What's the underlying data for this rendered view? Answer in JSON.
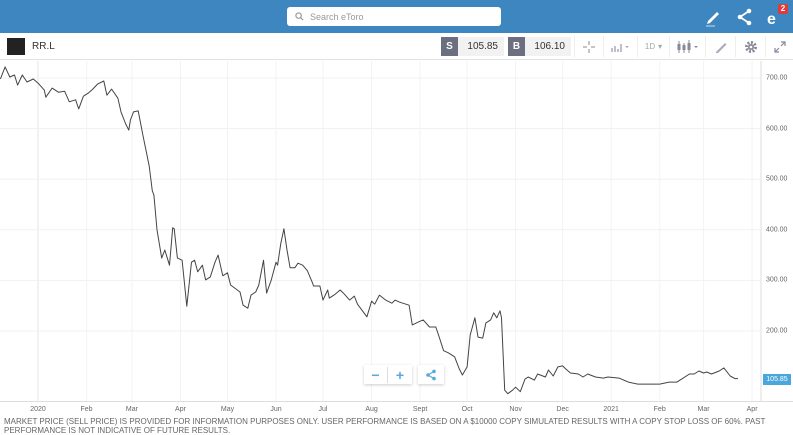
{
  "topbar": {
    "search_placeholder": "Search eToro",
    "notification_count": "2",
    "icons": [
      "edit-icon",
      "share-icon",
      "etoro-notifications-icon"
    ]
  },
  "toolbar": {
    "symbol": "RR.L",
    "sell_label": "S",
    "sell_price": "105.85",
    "buy_label": "B",
    "buy_price": "106.10",
    "timeframe": "1D",
    "icons": [
      "crosshair-icon",
      "chart-type-icon",
      "candles-icon",
      "draw-icon",
      "settings-icon",
      "fullscreen-icon"
    ]
  },
  "colors": {
    "topbar": "#3d86bf",
    "accent": "#4aa6db",
    "line": "#444444"
  },
  "chart_data": {
    "type": "line",
    "current_price_label": "105.85",
    "x_ticks": [
      "2020",
      "Feb",
      "Mar",
      "Apr",
      "May",
      "Jun",
      "Jul",
      "Aug",
      "Sept",
      "Oct",
      "Nov",
      "Dec",
      "2021",
      "Feb",
      "Mar",
      "Apr"
    ],
    "y_ticks": [
      "700.00",
      "600.00",
      "500.00",
      "400.00",
      "300.00",
      "200.00"
    ],
    "ylim": [
      60,
      740
    ],
    "grid": true,
    "series": [
      {
        "points": [
          [
            "2019-12-08",
            698
          ],
          [
            "2019-12-11",
            722
          ],
          [
            "2019-12-14",
            702
          ],
          [
            "2019-12-17",
            706
          ],
          [
            "2019-12-19",
            686
          ],
          [
            "2019-12-22",
            706
          ],
          [
            "2019-12-25",
            692
          ],
          [
            "2019-12-29",
            698
          ],
          [
            "2020-01-01",
            690
          ],
          [
            "2020-01-05",
            676
          ],
          [
            "2020-01-06",
            662
          ],
          [
            "2020-01-10",
            680
          ],
          [
            "2020-01-14",
            672
          ],
          [
            "2020-01-18",
            674
          ],
          [
            "2020-01-21",
            653
          ],
          [
            "2020-01-25",
            657
          ],
          [
            "2020-01-27",
            639
          ],
          [
            "2020-01-30",
            664
          ],
          [
            "2020-02-02",
            670
          ],
          [
            "2020-02-05",
            678
          ],
          [
            "2020-02-08",
            688
          ],
          [
            "2020-02-12",
            694
          ],
          [
            "2020-02-14",
            666
          ],
          [
            "2020-02-17",
            678
          ],
          [
            "2020-02-21",
            660
          ],
          [
            "2020-02-23",
            633
          ],
          [
            "2020-02-26",
            609
          ],
          [
            "2020-02-28",
            597
          ],
          [
            "2020-02-29",
            617
          ],
          [
            "2020-03-02",
            633
          ],
          [
            "2020-03-05",
            635
          ],
          [
            "2020-03-08",
            587
          ],
          [
            "2020-03-12",
            526
          ],
          [
            "2020-03-14",
            477
          ],
          [
            "2020-03-15",
            469
          ],
          [
            "2020-03-17",
            400
          ],
          [
            "2020-03-20",
            344
          ],
          [
            "2020-03-22",
            360
          ],
          [
            "2020-03-25",
            330
          ],
          [
            "2020-03-27",
            404
          ],
          [
            "2020-03-28",
            402
          ],
          [
            "2020-03-30",
            344
          ],
          [
            "2020-04-02",
            340
          ],
          [
            "2020-04-05",
            249
          ],
          [
            "2020-04-08",
            336
          ],
          [
            "2020-04-10",
            340
          ],
          [
            "2020-04-12",
            317
          ],
          [
            "2020-04-15",
            330
          ],
          [
            "2020-04-17",
            301
          ],
          [
            "2020-04-20",
            307
          ],
          [
            "2020-04-23",
            336
          ],
          [
            "2020-04-25",
            350
          ],
          [
            "2020-04-28",
            309
          ],
          [
            "2020-05-01",
            315
          ],
          [
            "2020-05-03",
            291
          ],
          [
            "2020-05-09",
            277
          ],
          [
            "2020-05-11",
            251
          ],
          [
            "2020-05-14",
            245
          ],
          [
            "2020-05-16",
            271
          ],
          [
            "2020-05-19",
            277
          ],
          [
            "2020-05-21",
            291
          ],
          [
            "2020-05-24",
            340
          ],
          [
            "2020-05-26",
            275
          ],
          [
            "2020-05-29",
            301
          ],
          [
            "2020-06-01",
            336
          ],
          [
            "2020-06-02",
            330
          ],
          [
            "2020-06-04",
            372
          ],
          [
            "2020-06-06",
            402
          ],
          [
            "2020-06-08",
            360
          ],
          [
            "2020-06-10",
            325
          ],
          [
            "2020-06-13",
            325
          ],
          [
            "2020-06-15",
            334
          ],
          [
            "2020-06-18",
            330
          ],
          [
            "2020-06-21",
            319
          ],
          [
            "2020-06-24",
            297
          ],
          [
            "2020-06-25",
            289
          ],
          [
            "2020-06-29",
            289
          ],
          [
            "2020-07-01",
            261
          ],
          [
            "2020-07-04",
            281
          ],
          [
            "2020-07-05",
            265
          ],
          [
            "2020-07-08",
            271
          ],
          [
            "2020-07-12",
            281
          ],
          [
            "2020-07-14",
            275
          ],
          [
            "2020-07-18",
            261
          ],
          [
            "2020-07-21",
            269
          ],
          [
            "2020-07-23",
            253
          ],
          [
            "2020-07-29",
            228
          ],
          [
            "2020-08-01",
            259
          ],
          [
            "2020-08-03",
            253
          ],
          [
            "2020-08-06",
            271
          ],
          [
            "2020-08-10",
            261
          ],
          [
            "2020-08-14",
            255
          ],
          [
            "2020-08-16",
            261
          ],
          [
            "2020-08-19",
            257
          ],
          [
            "2020-08-25",
            251
          ],
          [
            "2020-08-27",
            212
          ],
          [
            "2020-08-31",
            218
          ],
          [
            "2020-09-03",
            222
          ],
          [
            "2020-09-07",
            208
          ],
          [
            "2020-09-11",
            208
          ],
          [
            "2020-09-13",
            190
          ],
          [
            "2020-09-16",
            161
          ],
          [
            "2020-09-19",
            157
          ],
          [
            "2020-09-23",
            149
          ],
          [
            "2020-09-26",
            125
          ],
          [
            "2020-09-28",
            113
          ],
          [
            "2020-10-01",
            129
          ],
          [
            "2020-10-03",
            192
          ],
          [
            "2020-10-06",
            226
          ],
          [
            "2020-10-08",
            188
          ],
          [
            "2020-10-11",
            186
          ],
          [
            "2020-10-13",
            216
          ],
          [
            "2020-10-16",
            222
          ],
          [
            "2020-10-18",
            236
          ],
          [
            "2020-10-20",
            226
          ],
          [
            "2020-10-22",
            240
          ],
          [
            "2020-10-23",
            226
          ],
          [
            "2020-10-25",
            83
          ],
          [
            "2020-10-27",
            76
          ],
          [
            "2020-10-30",
            83
          ],
          [
            "2020-11-01",
            89
          ],
          [
            "2020-11-04",
            80
          ],
          [
            "2020-11-07",
            105
          ],
          [
            "2020-11-09",
            109
          ],
          [
            "2020-11-13",
            103
          ],
          [
            "2020-11-15",
            115
          ],
          [
            "2020-11-20",
            109
          ],
          [
            "2020-11-22",
            123
          ],
          [
            "2020-11-25",
            111
          ],
          [
            "2020-11-28",
            129
          ],
          [
            "2020-12-01",
            131
          ],
          [
            "2020-12-03",
            125
          ],
          [
            "2020-12-06",
            117
          ],
          [
            "2020-12-11",
            115
          ],
          [
            "2020-12-14",
            109
          ],
          [
            "2020-12-17",
            115
          ],
          [
            "2020-12-22",
            109
          ],
          [
            "2020-12-27",
            107
          ],
          [
            "2020-12-30",
            109
          ],
          [
            "2021-01-06",
            107
          ],
          [
            "2021-01-12",
            99
          ],
          [
            "2021-01-18",
            95
          ],
          [
            "2021-01-25",
            95
          ],
          [
            "2021-02-01",
            95
          ],
          [
            "2021-02-07",
            99
          ],
          [
            "2021-02-12",
            99
          ],
          [
            "2021-02-15",
            105
          ],
          [
            "2021-02-20",
            115
          ],
          [
            "2021-02-23",
            115
          ],
          [
            "2021-02-26",
            121
          ],
          [
            "2021-03-01",
            117
          ],
          [
            "2021-03-03",
            119
          ],
          [
            "2021-03-06",
            115
          ],
          [
            "2021-03-11",
            121
          ],
          [
            "2021-03-14",
            127
          ],
          [
            "2021-03-18",
            111
          ],
          [
            "2021-03-21",
            105.85
          ],
          [
            "2021-03-23",
            105.85
          ]
        ]
      }
    ]
  },
  "controls": {
    "zoom_out": "−",
    "zoom_in": "+",
    "share_icon": "share-icon"
  },
  "disclaimer": "MARKET PRICE (SELL PRICE) IS PROVIDED FOR INFORMATION PURPOSES ONLY. USER PERFORMANCE IS BASED ON A $10000 COPY SIMULATED RESULTS WITH A COPY STOP LOSS OF 60%. PAST PERFORMANCE IS NOT INDICATIVE OF FUTURE RESULTS."
}
